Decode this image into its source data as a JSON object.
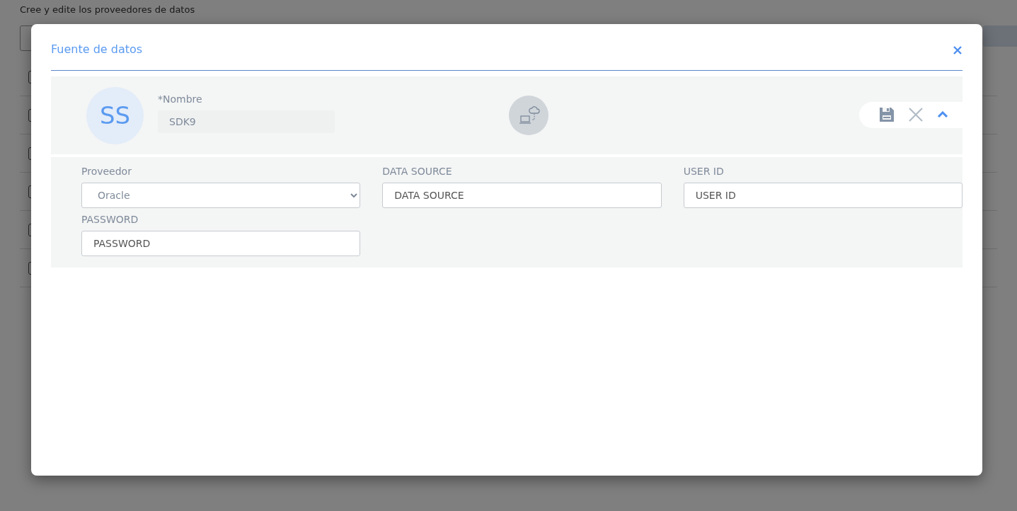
{
  "background": {
    "subtitle": "Cree y edite los proveedores de datos",
    "rows": [
      {
        "checked": false
      },
      {
        "checked": false
      },
      {
        "checked": false
      },
      {
        "checked": false
      },
      {
        "checked": false
      },
      {
        "checked": false
      }
    ]
  },
  "dialog": {
    "title": "Fuente de datos",
    "record": {
      "initials": "SS",
      "name_label": "*Nombre",
      "name_value": "SDK9"
    },
    "fields": [
      {
        "kind": "select",
        "label": "Proveedor",
        "value": "Oracle"
      },
      {
        "kind": "input",
        "label": "DATA SOURCE",
        "placeholder": "DATA SOURCE"
      },
      {
        "kind": "input",
        "label": "USER ID",
        "placeholder": "USER ID"
      },
      {
        "kind": "input",
        "label": "PASSWORD",
        "placeholder": "PASSWORD"
      }
    ]
  }
}
